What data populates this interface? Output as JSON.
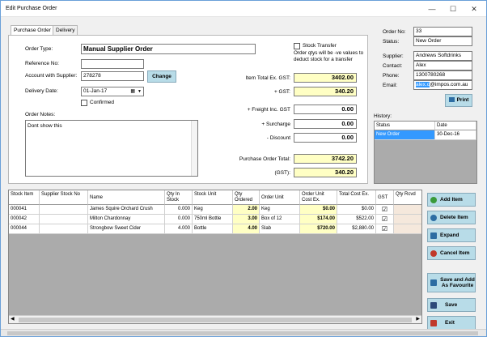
{
  "window": {
    "title": "Edit Purchase Order",
    "min": "—",
    "max": "☐",
    "close": "✕"
  },
  "tabs": [
    "Purchase Order",
    "Delivery"
  ],
  "form": {
    "order_type_label": "Order Type:",
    "order_type_value": "Manual Supplier Order",
    "reference_label": "Reference No:",
    "reference_value": "",
    "account_label": "Account with Supplier:",
    "account_value": "278278",
    "change_button": "Change",
    "delivery_label": "Delivery Date:",
    "delivery_value": "01-Jan-17",
    "confirmed_label": "Confirmed",
    "notes_label": "Order Notes:",
    "notes_value": "Dont show this"
  },
  "stock_transfer": {
    "label": "Stock Transfer",
    "note": "Order qtys will be -ve values to deduct stock for a transfer"
  },
  "totals": {
    "item_total_label": "Item Total Ex. GST:",
    "item_total": "3402.00",
    "gst_label": "+ GST:",
    "gst": "340.20",
    "freight_label": "+ Freight Inc. GST",
    "freight": "0.00",
    "surcharge_label": "+ Surcharge",
    "surcharge": "0.00",
    "discount_label": "- Discount",
    "discount": "0.00",
    "po_total_label": "Purchase Order Total:",
    "po_total": "3742.20",
    "gst2_label": "(GST):",
    "gst2": "340.20"
  },
  "supplier_info": {
    "order_no_label": "Order No:",
    "order_no": "33",
    "status_label": "Status:",
    "status": "New Order",
    "supplier_label": "Supplier:",
    "supplier": "Andrews Softdrinks",
    "contact_label": "Contact:",
    "contact": "Alex",
    "phone_label": "Phone:",
    "phone": "1300780268",
    "email_label": "Email:",
    "email_sel": "alex.o",
    "email_rest": "@impos.com.au",
    "print_button": "Print"
  },
  "history": {
    "label": "History:",
    "headers": [
      "Status",
      "Date"
    ],
    "rows": [
      {
        "status": "New Order",
        "date": "30-Dec-16"
      }
    ]
  },
  "grid": {
    "headers": [
      "Stock Item",
      "Supplier Stock No",
      "Name",
      "Qty In Stock",
      "Stock Unit",
      "Qty Ordered",
      "Order Unit",
      "Order Unit Cost Ex.",
      "Total Cost Ex.",
      "GST",
      "Qty Rcvd"
    ],
    "rows": [
      {
        "item": "000041",
        "supp": "",
        "name": "James Squire Orchard Crush",
        "instock": "0.000",
        "unit": "Keg",
        "ordered": "2.00",
        "ounit": "Keg",
        "ucost": "$0.00",
        "tcost": "$0.00",
        "gst": "☑"
      },
      {
        "item": "000042",
        "supp": "",
        "name": "Milton Chardonnay",
        "instock": "0.000",
        "unit": "750ml Bottle",
        "ordered": "3.00",
        "ounit": "Box of 12",
        "ucost": "$174.00",
        "tcost": "$522.00",
        "gst": "☑"
      },
      {
        "item": "000044",
        "supp": "",
        "name": "Strongbow Sweet Cider",
        "instock": "4.000",
        "unit": "Bottle",
        "ordered": "4.00",
        "ounit": "Slab",
        "ucost": "$720.00",
        "tcost": "$2,880.00",
        "gst": "☑"
      }
    ]
  },
  "actions": {
    "add_item": "Add Item",
    "delete_item": "Delete Item",
    "expand": "Expand",
    "cancel_item": "Cancel Item",
    "save_add_fav": "Save and Add As Favourite",
    "save": "Save",
    "exit": "Exit"
  }
}
